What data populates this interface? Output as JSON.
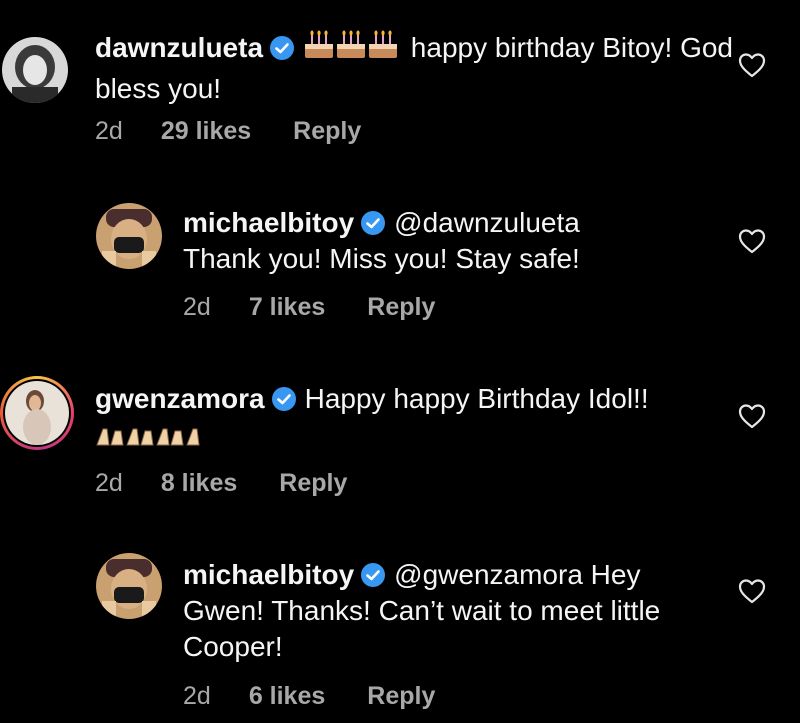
{
  "comments": [
    {
      "username": "dawnzulueta",
      "body": " happy birthday Bitoy! God bless you!",
      "emoji": [
        "birthday-cake",
        "birthday-cake",
        "birthday-cake"
      ],
      "time": "2d",
      "likes": "29 likes",
      "reply": "Reply",
      "verified": true
    },
    {
      "username": "michaelbitoy",
      "mention": "@dawnzulueta",
      "body": "Thank you! Miss you! Stay safe!",
      "time": "2d",
      "likes": "7 likes",
      "reply": "Reply",
      "verified": true
    },
    {
      "username": "gwenzamora",
      "body": "Happy happy Birthday Idol!!",
      "emoji": [
        "clapping-hands",
        "clapping-hands",
        "clapping-hands"
      ],
      "time": "2d",
      "likes": "8 likes",
      "reply": "Reply",
      "verified": true
    },
    {
      "username": "michaelbitoy",
      "mention": "@gwenzamora",
      "body": " Hey Gwen! Thanks! Can’t wait to meet little Cooper!",
      "time": "2d",
      "likes": "6 likes",
      "reply": "Reply",
      "verified": true
    }
  ],
  "icons": {
    "verified": "verified-badge-icon",
    "like": "heart-outline-icon"
  },
  "colors": {
    "background": "#000000",
    "text": "#f5f5f5",
    "meta": "#a8a8a8",
    "verified": "#3897f0"
  }
}
